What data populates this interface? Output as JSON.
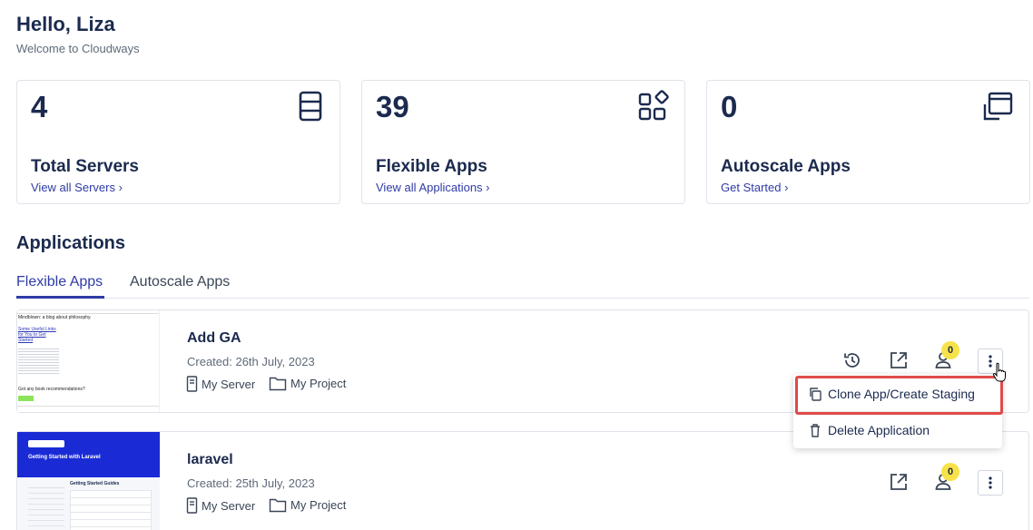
{
  "header": {
    "greeting": "Hello, Liza",
    "subtitle": "Welcome to Cloudways"
  },
  "stats": [
    {
      "value": "4",
      "title": "Total Servers",
      "link": "View all Servers ›",
      "icon": "server-stack-icon"
    },
    {
      "value": "39",
      "title": "Flexible Apps",
      "link": "View all Applications ›",
      "icon": "apps-grid-icon"
    },
    {
      "value": "0",
      "title": "Autoscale Apps",
      "link": "Get Started ›",
      "icon": "autoscale-window-icon"
    }
  ],
  "applications": {
    "title": "Applications",
    "tabs": [
      {
        "label": "Flexible Apps",
        "active": true
      },
      {
        "label": "Autoscale Apps",
        "active": false
      }
    ],
    "items": [
      {
        "name": "Add GA",
        "created": "Created: 26th July, 2023",
        "server": "My Server",
        "project": "My Project",
        "collaborators": "0",
        "thumb": {
          "heading": "Mindblown: a blog about philosophy.",
          "link_lines": [
            "Some Useful Links",
            "for You to Get",
            "Started"
          ],
          "question": "Got any book recommendations?"
        }
      },
      {
        "name": "laravel",
        "created": "Created: 25th July, 2023",
        "server": "My Server",
        "project": "My Project",
        "collaborators": "0",
        "thumb": {
          "heading": "Getting Started with Laravel",
          "guides": "Getting Started Guides"
        }
      }
    ]
  },
  "context_menu": {
    "items": [
      {
        "label": "Clone App/Create Staging",
        "icon": "copy-icon"
      },
      {
        "label": "Delete Application",
        "icon": "trash-icon"
      }
    ]
  },
  "colors": {
    "brand_blue": "#2f3ba6",
    "text_dark": "#1b2a4e",
    "badge_yellow": "#f7e24a",
    "highlight_red": "#e04a4a",
    "laravel_banner": "#1a2bd6"
  }
}
